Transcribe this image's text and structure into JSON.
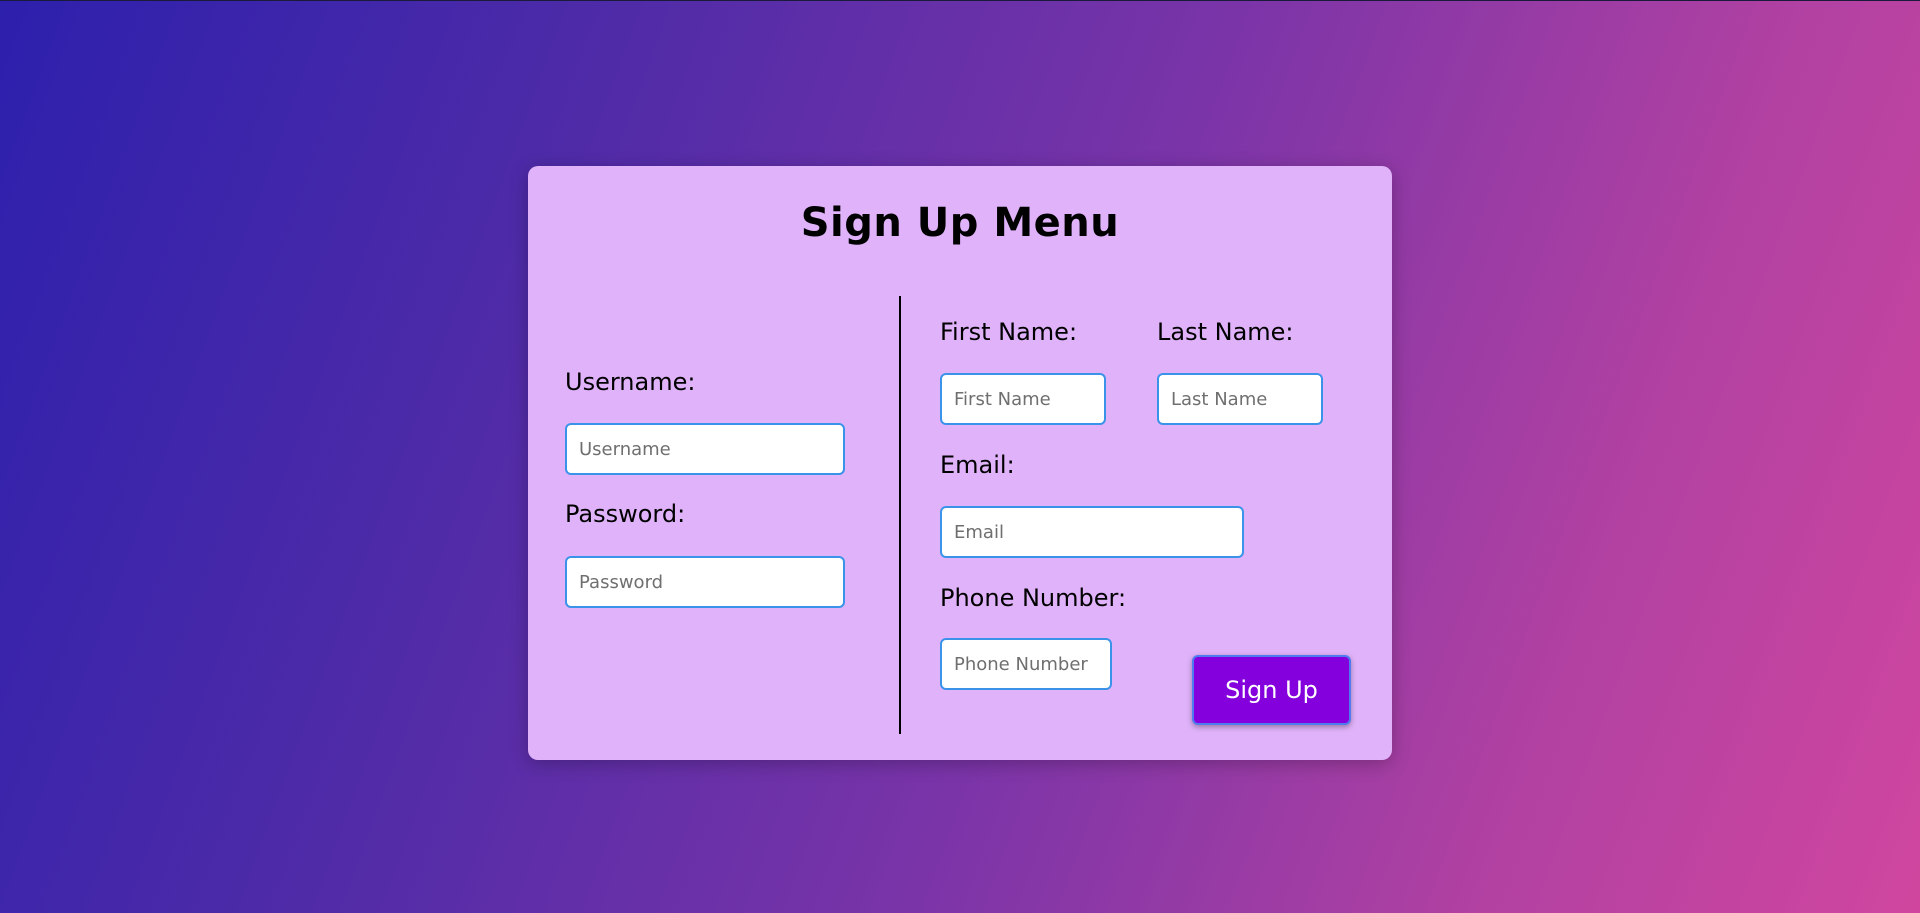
{
  "title": "Sign Up Menu",
  "login": {
    "username_label": "Username:",
    "username_placeholder": "Username",
    "password_label": "Password:",
    "password_placeholder": "Password"
  },
  "register": {
    "first_name_label": "First Name:",
    "first_name_placeholder": "First Name",
    "last_name_label": "Last Name:",
    "last_name_placeholder": "Last Name",
    "email_label": "Email:",
    "email_placeholder": "Email",
    "phone_label": "Phone Number:",
    "phone_placeholder": "Phone Number"
  },
  "submit_label": "Sign Up",
  "colors": {
    "card_background": "#e0b2fa",
    "button_background": "#8400dd",
    "input_border": "#3a93e8"
  }
}
